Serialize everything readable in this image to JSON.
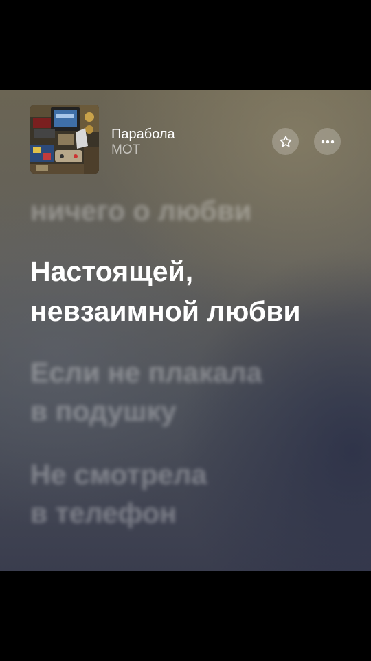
{
  "track": {
    "title": "Парабола",
    "artist": "МОТ"
  },
  "icons": {
    "favorite": "star-icon",
    "more": "more-icon"
  },
  "lyrics": {
    "previous": "ничего о любви",
    "current": [
      "Настоящей,",
      "невзаимной любви"
    ],
    "next1": [
      "Если не плакала",
      "в подушку"
    ],
    "next2": [
      "Не смотрела",
      "в телефон"
    ]
  },
  "colors": {
    "active_lyric": "#ffffff",
    "inactive_lyric": "rgba(255,255,255,0.32)",
    "button_bg": "rgba(255,255,255,0.22)"
  }
}
